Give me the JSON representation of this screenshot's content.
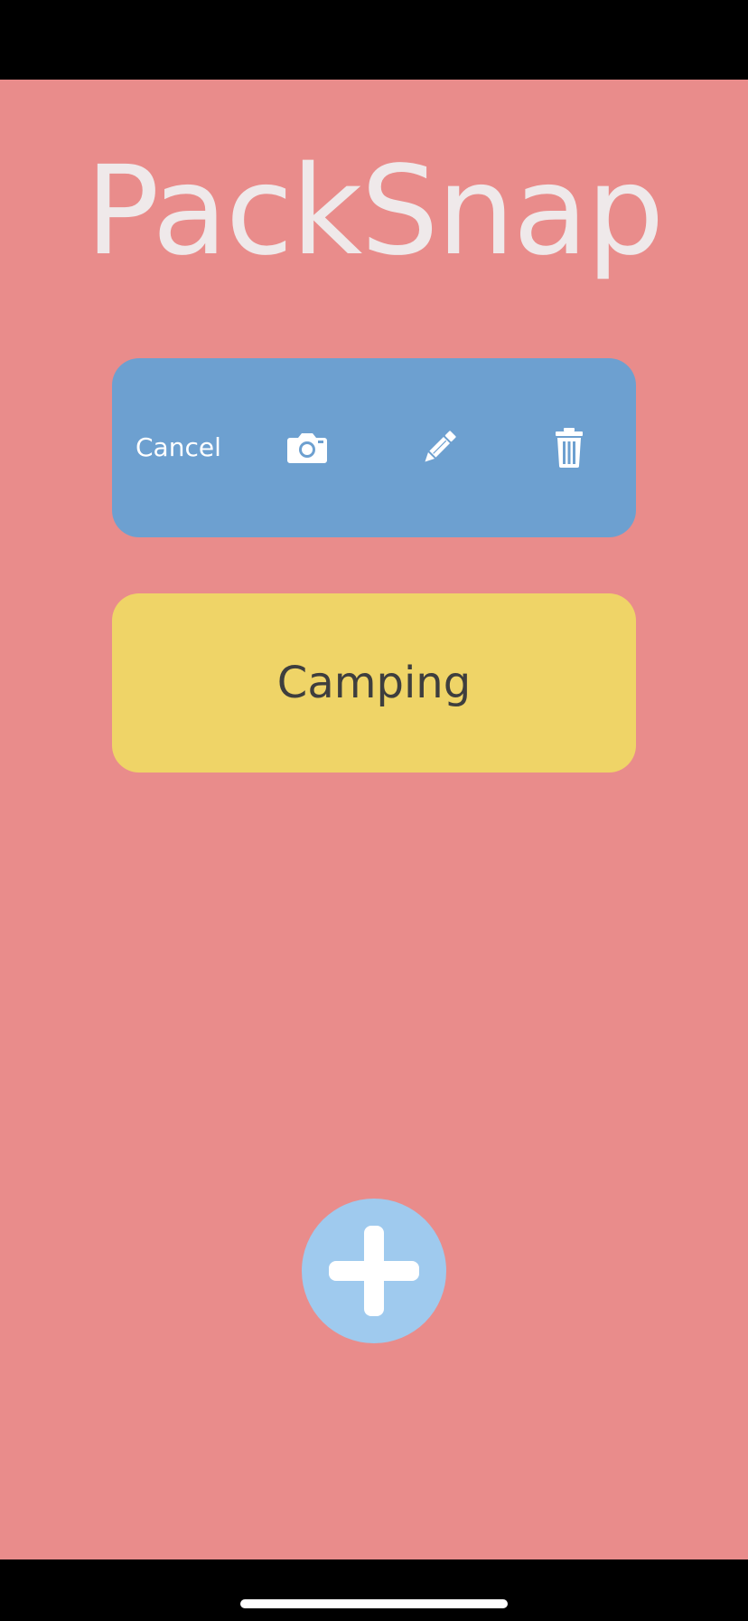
{
  "app": {
    "title": "PackSnap"
  },
  "action_card": {
    "cancel_label": "Cancel",
    "icons": [
      "camera-icon",
      "pencil-icon",
      "trash-icon"
    ]
  },
  "lists": [
    {
      "label": "Camping"
    }
  ],
  "add_button": {
    "icon": "plus-icon"
  },
  "colors": {
    "background": "#e98c8b",
    "title": "#efe9ea",
    "action_card": "#6da0d0",
    "list_card": "#efd467",
    "list_text": "#3e3e3e",
    "add_button": "#9fcaee",
    "icon": "#ffffff"
  }
}
